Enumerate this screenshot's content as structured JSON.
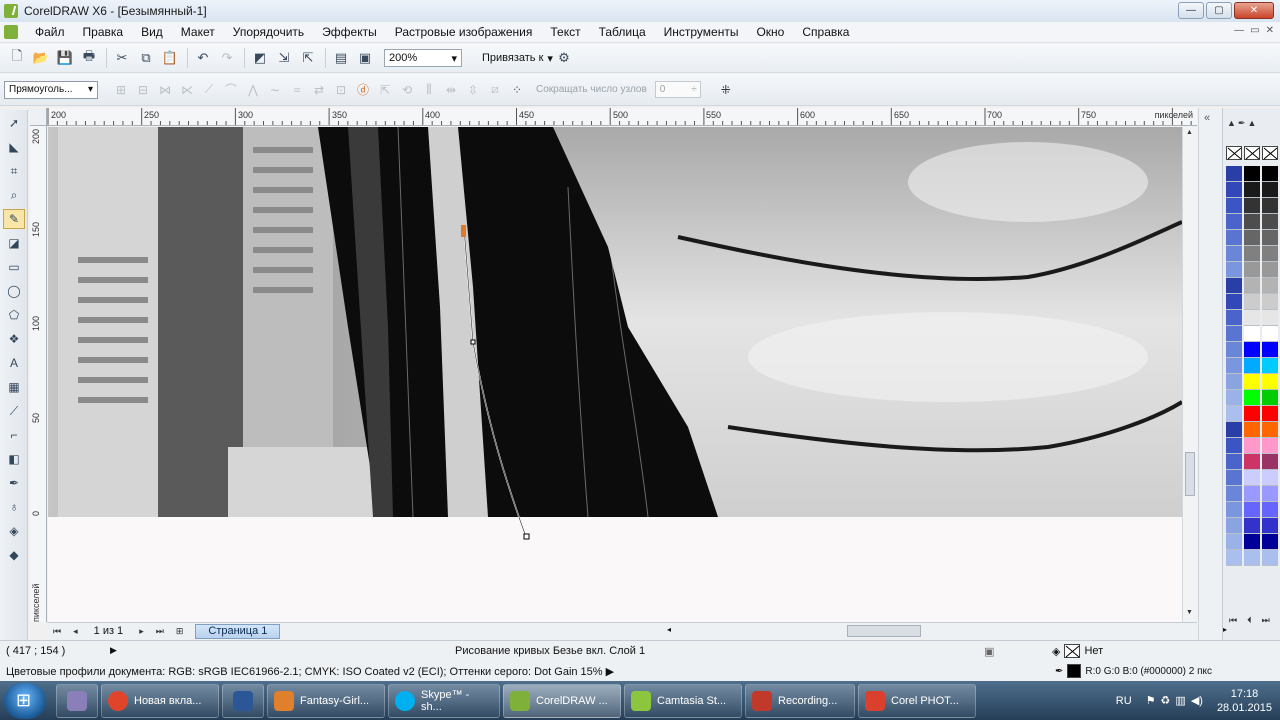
{
  "window": {
    "title": "CorelDRAW X6 - [Безымянный-1]",
    "controls": {
      "minimize": "—",
      "maximize": "▢",
      "close": "✕"
    }
  },
  "menu": {
    "items": [
      "Файл",
      "Правка",
      "Вид",
      "Макет",
      "Упорядочить",
      "Эффекты",
      "Растровые изображения",
      "Текст",
      "Таблица",
      "Инструменты",
      "Окно",
      "Справка"
    ],
    "doc_controls": {
      "minimize": "—",
      "restore": "▭",
      "close": "✕"
    }
  },
  "toolbar1": {
    "zoom": "200%",
    "snap_label": "Привязать к"
  },
  "toolbar2": {
    "shape_select": "Прямоуголь...",
    "reduce_nodes_label": "Сокращать число узлов",
    "reduce_nodes_value": "0"
  },
  "ruler": {
    "h_labels": [
      "200",
      "250",
      "300",
      "350",
      "400",
      "450",
      "500",
      "550",
      "600",
      "650",
      "700",
      "750"
    ],
    "h_unit": "пикселей",
    "v_labels": [
      "200",
      "150",
      "100",
      "50",
      "0"
    ],
    "v_unit": "пикселей"
  },
  "pagebar": {
    "page_count": "1 из 1",
    "page_tab": "Страница 1"
  },
  "status": {
    "coords": "( 417  ; 154  )",
    "message": "Рисование кривых Безье вкл. Слой 1",
    "profiles": "Цветовые профили документа: RGB: sRGB IEC61966-2.1; CMYK: ISO Coated v2 (ECI); Оттенки серого: Dot Gain 15%",
    "fill": "Нет",
    "outline": "R:0 G:0 B:0 (#000000)  2 пкс"
  },
  "palette": {
    "col1": [
      "#2a3ea8",
      "#3348b8",
      "#3b55c4",
      "#4a64cc",
      "#5a74d2",
      "#6a86d8",
      "#7a96de",
      "#2a3ea8",
      "#3348b8",
      "#4a64cc",
      "#5a74d2",
      "#6a86d8",
      "#7a96de",
      "#8aa4e2",
      "#9ab2e8",
      "#aabfee",
      "#2a3ea8",
      "#3b55c4",
      "#4a64cc",
      "#5a74d2",
      "#6a86d8",
      "#7a96de",
      "#8aa4e2",
      "#9ab2e8",
      "#aabfee"
    ],
    "col2": [
      "#000000",
      "#1a1a1a",
      "#333333",
      "#4d4d4d",
      "#666666",
      "#808080",
      "#999999",
      "#b3b3b3",
      "#cccccc",
      "#e6e6e6",
      "#ffffff",
      "#0000ff",
      "#00aaff",
      "#ffff00",
      "#00ff00",
      "#ff0000",
      "#ff6600",
      "#ff99cc",
      "#cc3366",
      "#ccccff",
      "#9999ff",
      "#6666ff",
      "#3333cc",
      "#000099",
      "#aabfee"
    ],
    "col3": [
      "#000000",
      "#1a1a1a",
      "#333333",
      "#4d4d4d",
      "#666666",
      "#808080",
      "#999999",
      "#b3b3b3",
      "#cccccc",
      "#e6e6e6",
      "#ffffff",
      "#0000ff",
      "#00ccff",
      "#ffff00",
      "#00cc00",
      "#ff0000",
      "#ff6600",
      "#ff99cc",
      "#993366",
      "#ccccff",
      "#9999ff",
      "#6666ff",
      "#3333cc",
      "#000099",
      "#aabfee"
    ]
  },
  "taskbar": {
    "apps": [
      {
        "label": "Новая вкла...",
        "icon_color": "#e0452c",
        "icon": "chrome-icon"
      },
      {
        "label": "Fantasy-Girl...",
        "icon_color": "#e07f2c",
        "icon": "eye-icon"
      },
      {
        "label": "Skype™ - sh...",
        "icon_color": "#00aff0",
        "icon": "skype-icon"
      },
      {
        "label": "CorelDRAW ...",
        "icon_color": "#7fb03a",
        "icon": "coreldraw-icon"
      },
      {
        "label": "Camtasia St...",
        "icon_color": "#8cc63f",
        "icon": "camtasia-icon"
      },
      {
        "label": "Recording...",
        "icon_color": "#c0392b",
        "icon": "recording-icon"
      },
      {
        "label": "Corel PHOT...",
        "icon_color": "#d9412e",
        "icon": "corel-photo-icon"
      }
    ],
    "lang": "RU",
    "time": "17:18",
    "date": "28.01.2015"
  }
}
